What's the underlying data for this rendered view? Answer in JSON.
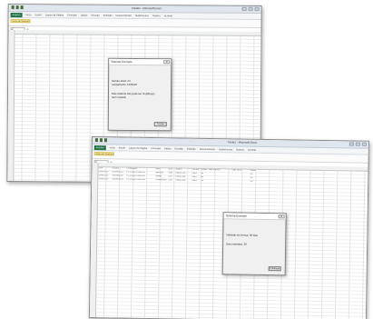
{
  "windows": [
    {
      "title": "Pasta1 - Microsoft Excel",
      "quick_access": "▣ ↶ ↷ ▾",
      "tabs": [
        "Arquivo",
        "Início",
        "Inserir",
        "Layout da Página",
        "Fórmulas",
        "Dados",
        "Revisão",
        "Exibição",
        "Desenvolvedor",
        "Suplementos",
        "Nuance",
        "Acrobat"
      ],
      "message_bar": "Aviso de Segurança",
      "name_box": "A1",
      "fx": "fx",
      "dialog": {
        "title": "Sistema Exemplo",
        "close": "✕",
        "lines": [
          "Versão atual: 2.5",
          "Lançamento: 15/05/10",
          "",
          "Este sistema não pode ser modificado",
          "nem copiado"
        ],
        "button": "Fechar"
      }
    },
    {
      "title": "Pasta1 - Microsoft Excel",
      "quick_access": "▣ ↶ ↷ ▾",
      "tabs": [
        "Arquivo",
        "Início",
        "Inserir",
        "Layout da Página",
        "Fórmulas",
        "Dados",
        "Revisão",
        "Exibição",
        "Desenvolvedor",
        "Suplementos",
        "Nuance",
        "Acrobat"
      ],
      "message_bar": "Aviso de Segurança",
      "name_box": "A1",
      "fx": "fx",
      "table": {
        "headers": [
          "Data",
          "Usuário",
          "Computador",
          "Ação",
          "Nível",
          "Arquivo",
          "Planilha",
          "Célula",
          "Valor Anterior",
          "Valor Novo",
          "Status"
        ],
        "rows": [
          [
            "01/06/2010",
            "USUARIO01",
            "PC-ESCRITORIO-01",
            "Abertura",
            "ADM",
            "Pasta1.xlsx",
            "Plan1",
            "A1",
            "",
            "",
            "OK"
          ],
          [
            "01/06/2010",
            "USUARIO02",
            "PC-ESCRITORIO-02",
            "Edição",
            "USR",
            "Pasta1.xlsx",
            "Plan1",
            "B2",
            "",
            "",
            "OK"
          ],
          [
            "01/06/2010",
            "USUARIO03",
            "PC-ESCRITORIO-03",
            "Fechamento",
            "USR",
            "Pasta1.xlsx",
            "Plan1",
            "C3",
            "",
            "",
            "OK"
          ]
        ]
      },
      "dialog": {
        "title": "Sistema Exemplo",
        "close": "✕",
        "lines": [
          "Validade da licença: 30 dias",
          "",
          "Dias restantes: 29"
        ],
        "button": "Continuar"
      }
    }
  ]
}
